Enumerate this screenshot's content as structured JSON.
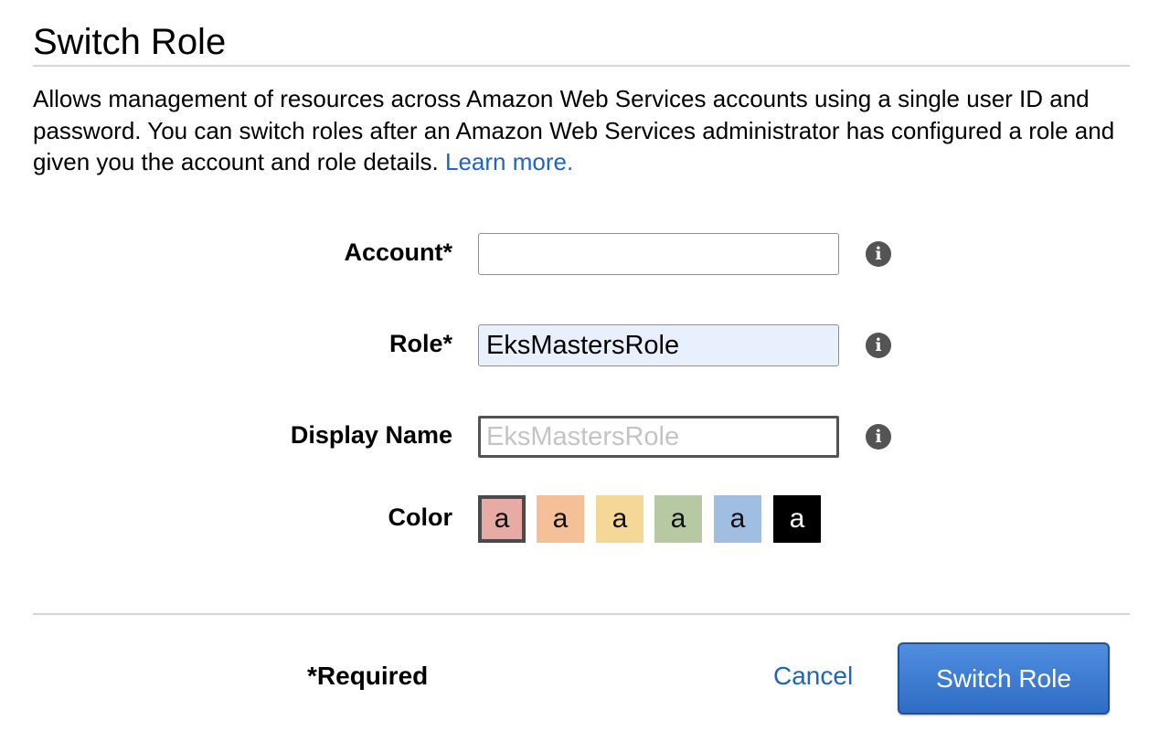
{
  "title": "Switch Role",
  "description": {
    "text": "Allows management of resources across Amazon Web Services accounts using a single user ID and password. You can switch roles after an Amazon Web Services administrator has configured a role and given you the account and role details.",
    "link": "Learn more."
  },
  "form": {
    "account": {
      "label": "Account*",
      "value": "",
      "placeholder": ""
    },
    "role": {
      "label": "Role*",
      "value": "EksMastersRole",
      "placeholder": ""
    },
    "display_name": {
      "label": "Display Name",
      "value": "",
      "placeholder": "EksMastersRole"
    },
    "color": {
      "label": "Color",
      "selected_index": 0,
      "swatches": [
        {
          "letter": "a",
          "color": "#e8aaa4"
        },
        {
          "letter": "a",
          "color": "#f5c098"
        },
        {
          "letter": "a",
          "color": "#f5d898"
        },
        {
          "letter": "a",
          "color": "#b6c9a3"
        },
        {
          "letter": "a",
          "color": "#a0bde2"
        },
        {
          "letter": "a",
          "color": "#000000"
        }
      ]
    },
    "info_icon": "i"
  },
  "footer": {
    "required_note": "*Required",
    "cancel_label": "Cancel",
    "submit_label": "Switch Role"
  },
  "colors": {
    "link": "#1f63c4",
    "primary_button": "#3a78d1",
    "autofill_background": "#e8f0fe"
  },
  "icons": {
    "info": "info-circle-icon"
  }
}
